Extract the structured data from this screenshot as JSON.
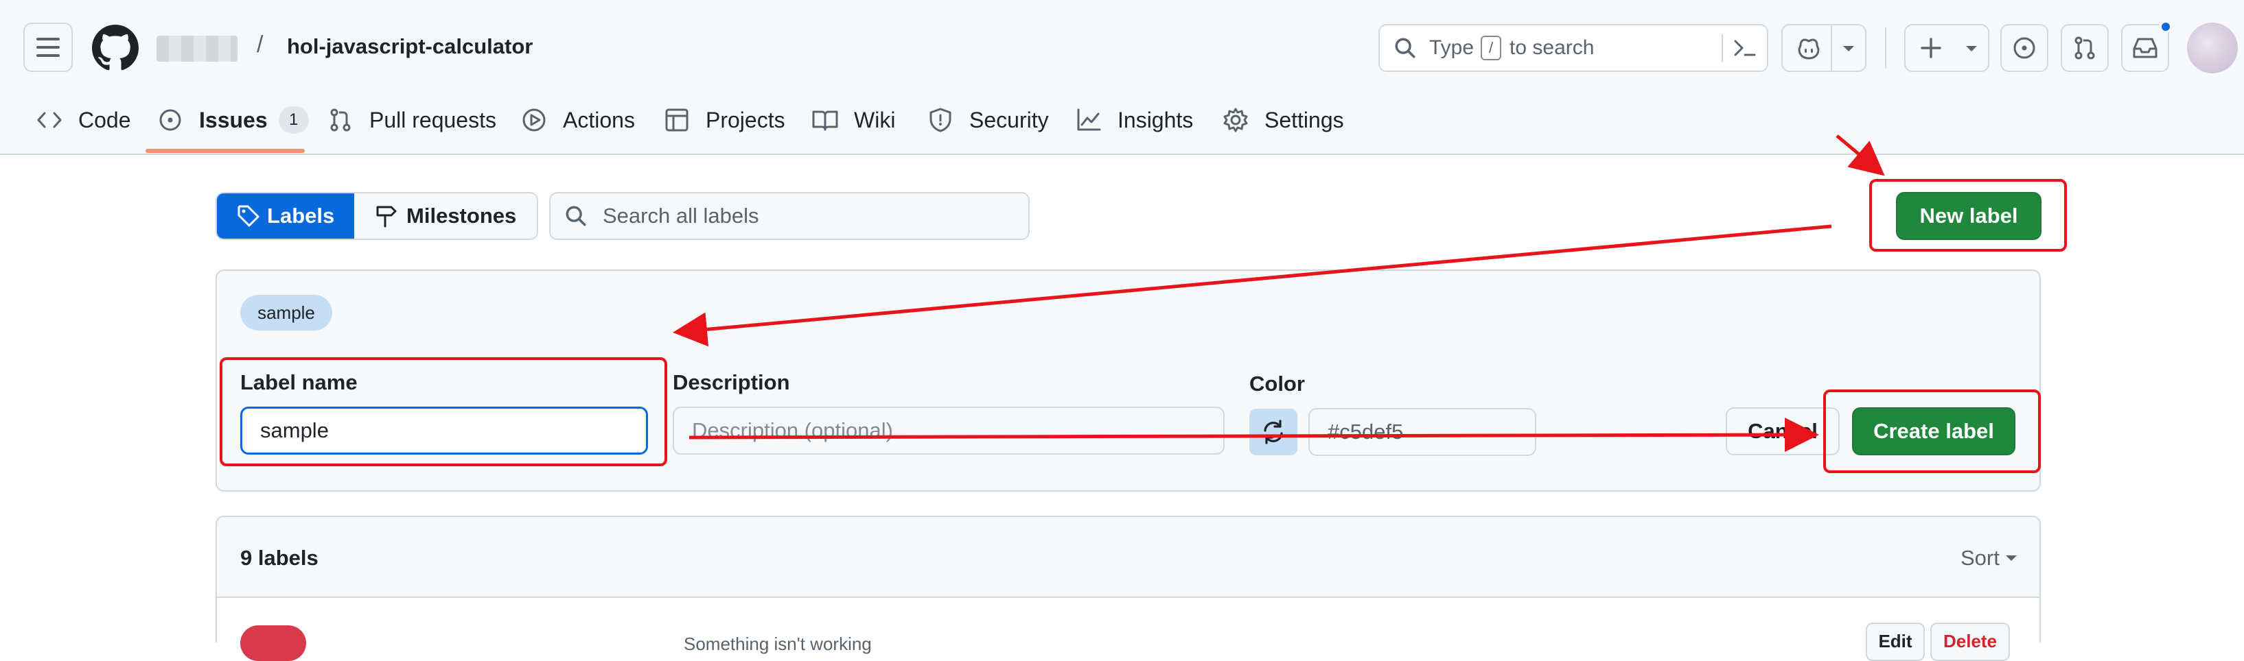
{
  "header": {
    "owner_placeholder": "",
    "separator": "/",
    "repo_name": "hol-javascript-calculator",
    "search": {
      "prefix": "Type",
      "key": "/",
      "suffix": "to search"
    }
  },
  "nav": {
    "tabs": [
      {
        "label": "Code"
      },
      {
        "label": "Issues",
        "count": "1"
      },
      {
        "label": "Pull requests"
      },
      {
        "label": "Actions"
      },
      {
        "label": "Projects"
      },
      {
        "label": "Wiki"
      },
      {
        "label": "Security"
      },
      {
        "label": "Insights"
      },
      {
        "label": "Settings"
      }
    ]
  },
  "toolbar": {
    "labels_tab": "Labels",
    "milestones_tab": "Milestones",
    "search_placeholder": "Search all labels",
    "new_label_button": "New label"
  },
  "form": {
    "preview_label": "sample",
    "label_name_title": "Label name",
    "label_name_value": "sample",
    "description_title": "Description",
    "description_placeholder": "Description (optional)",
    "color_title": "Color",
    "color_value": "#c5def5",
    "cancel_button": "Cancel",
    "create_button": "Create label"
  },
  "list": {
    "count_label": "9 labels",
    "sort_label": "Sort",
    "first_row_description": "Something isn't working",
    "edit_button": "Edit",
    "delete_button": "Delete"
  },
  "colors": {
    "accent_blue": "#0969da",
    "primary_green": "#1f883d",
    "annotation_red": "#e8141c",
    "label_color": "#c5def5"
  }
}
